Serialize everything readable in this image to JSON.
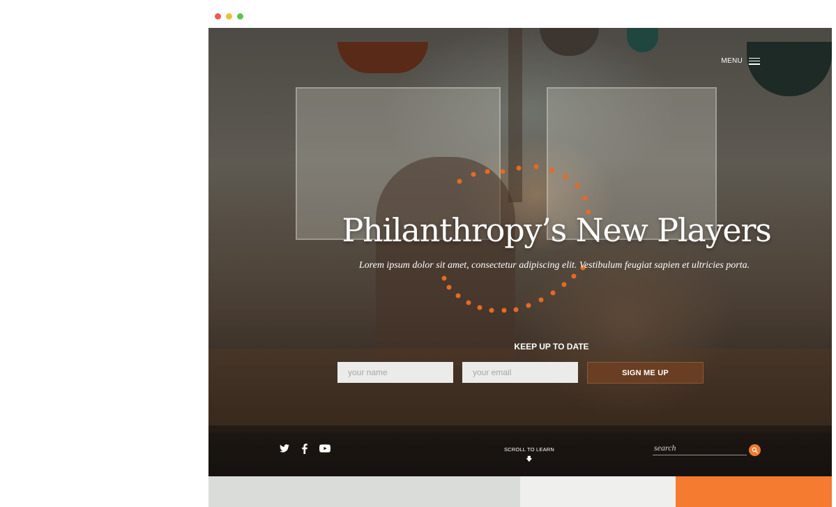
{
  "colors": {
    "accent": "#f47b30",
    "button": "#6a3e22",
    "field": "#ebebea"
  },
  "header": {
    "menu_label": "MENU",
    "menu_icon": "hamburger-icon"
  },
  "hero": {
    "title": "Philanthropy’s New Players",
    "subtitle": "Lorem ipsum dolor sit amet, consectetur adipiscing elit. Vestibulum feugiat sapien et ultricies porta."
  },
  "signup": {
    "heading": "KEEP UP TO DATE",
    "name_placeholder": "your name",
    "email_placeholder": "your email",
    "button_label": "SIGN ME UP"
  },
  "footer": {
    "social_icons": [
      "twitter-icon",
      "facebook-icon",
      "youtube-icon"
    ],
    "scroll_label": "SCROLL TO LEARN",
    "search_placeholder": "search",
    "search_icon": "search-icon"
  }
}
